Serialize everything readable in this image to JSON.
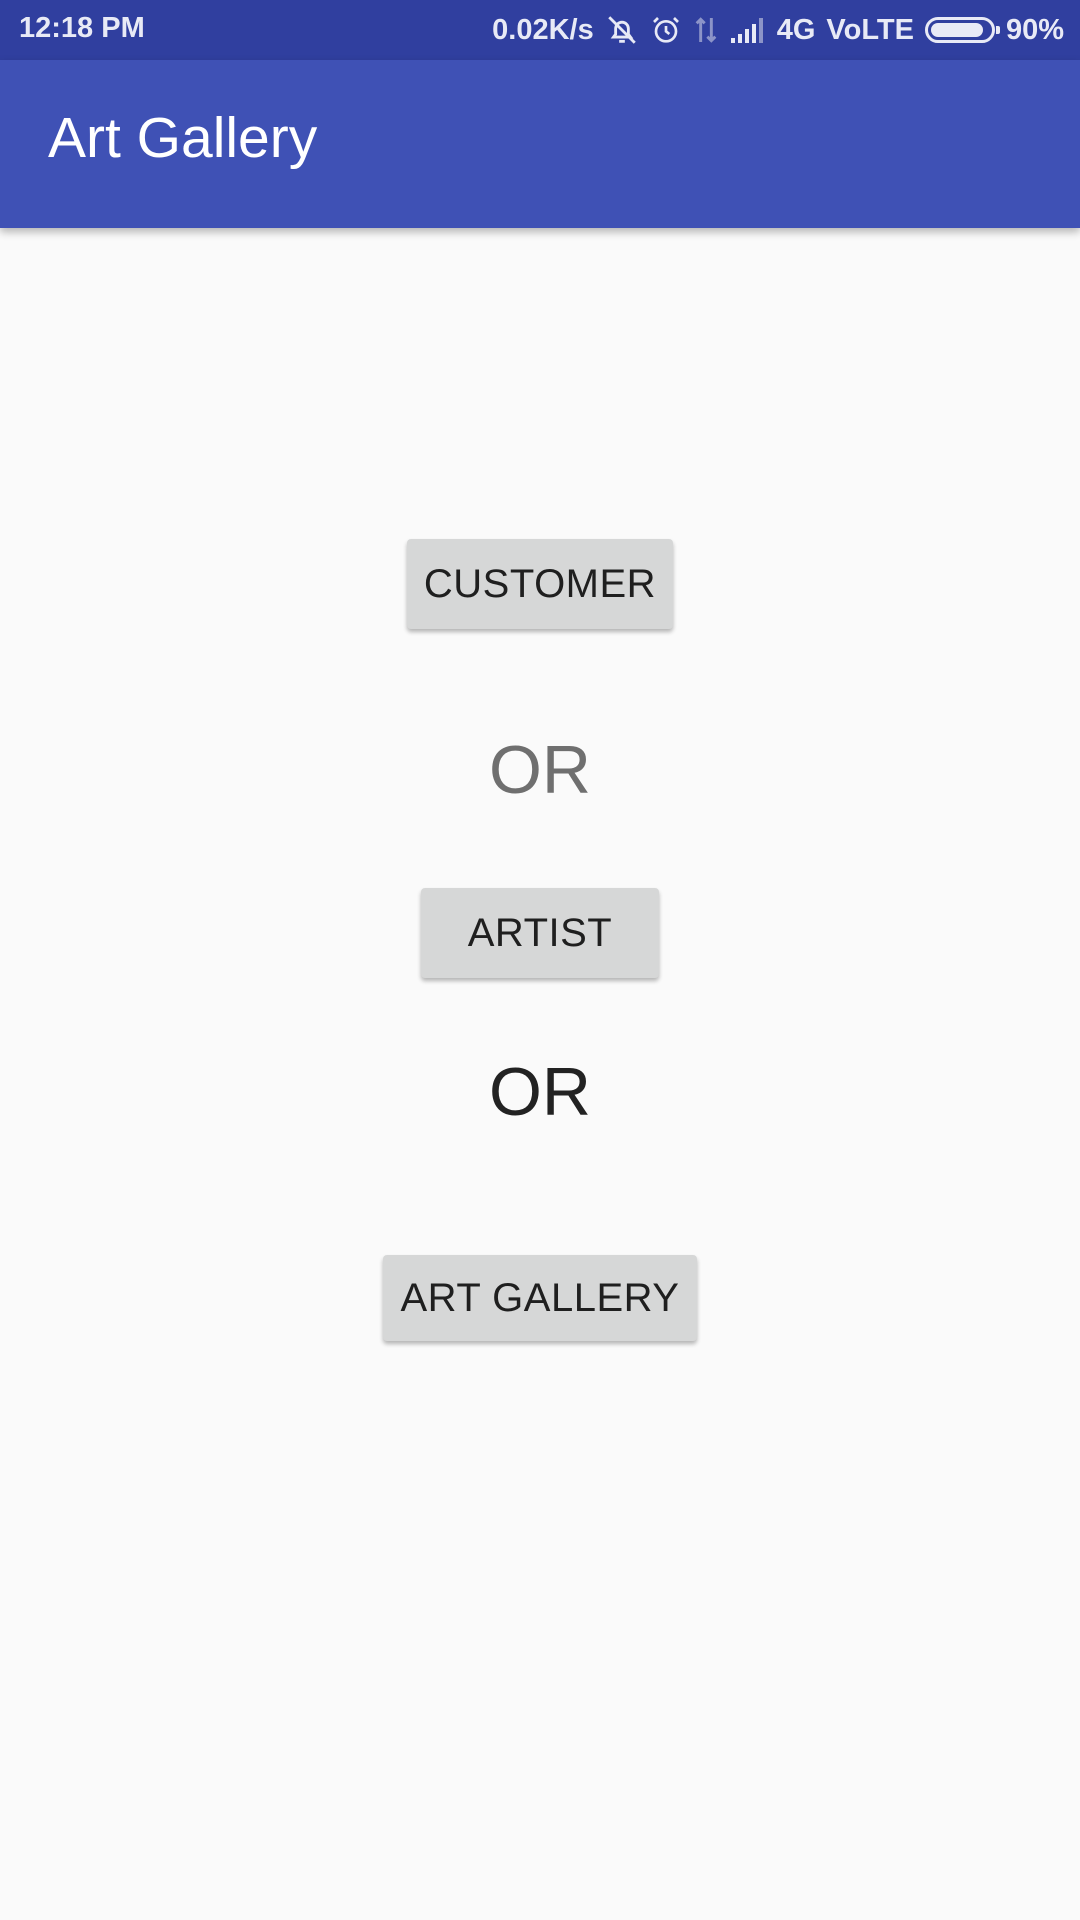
{
  "status_bar": {
    "time": "12:18 PM",
    "net_speed": "0.02K/s",
    "network": "4G",
    "volte": "VoLTE",
    "battery": "90%",
    "battery_level": 0.9,
    "icons": [
      "bell-off-icon",
      "alarm-icon",
      "data-arrows-icon",
      "signal-icon",
      "battery-icon"
    ]
  },
  "app_bar": {
    "title": "Art Gallery",
    "color": "#3f51b5"
  },
  "main": {
    "customer_button": "CUSTOMER",
    "or_1": "OR",
    "artist_button": "ARTIST",
    "or_2": "OR",
    "gallery_button": "ART GALLERY"
  }
}
